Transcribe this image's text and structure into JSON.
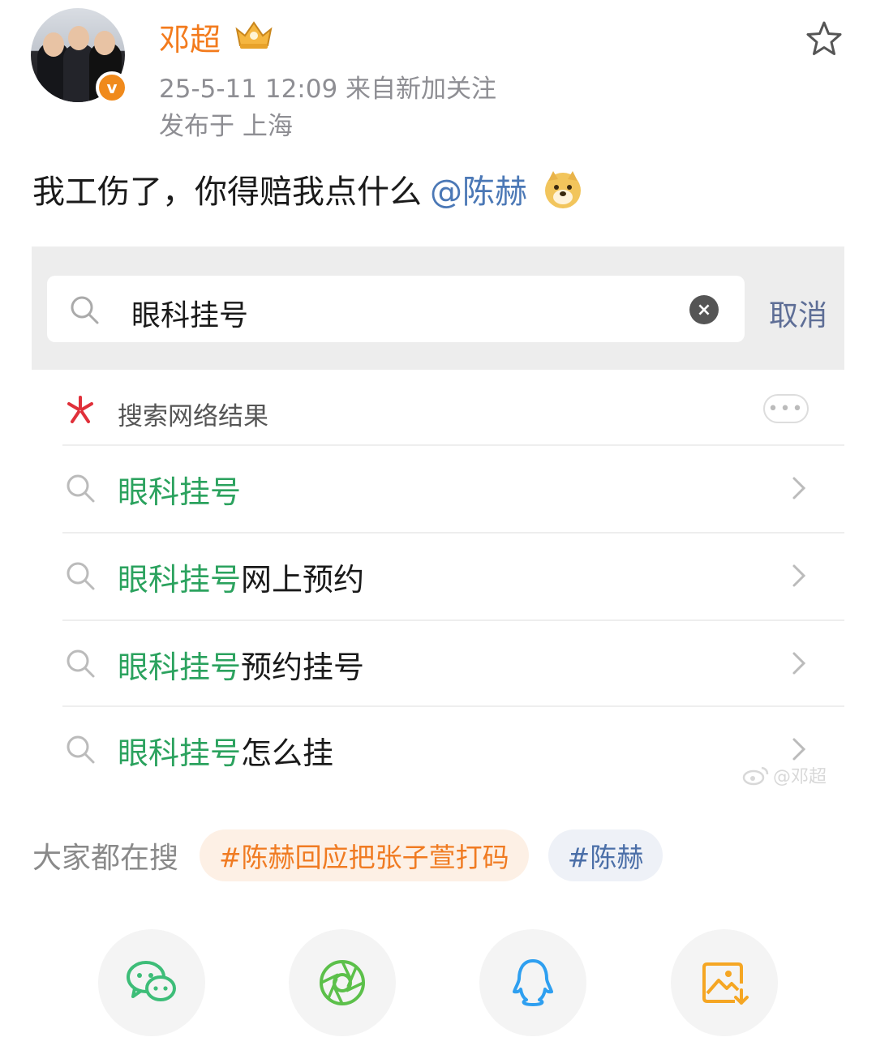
{
  "post": {
    "username": "邓超",
    "verified_mark": "v",
    "meta": "25-5-11 12:09  来自新加关注",
    "location": "发布于 上海",
    "text": "我工伤了，你得赔我点什么",
    "mention": "@陈赫"
  },
  "screenshot": {
    "search_query": "眼科挂号",
    "cancel_label": "取消",
    "clear_label": "×",
    "web_results_label": "搜索网络结果",
    "more_label": "•••",
    "suggestions": [
      {
        "highlight": "眼科挂号",
        "rest": ""
      },
      {
        "highlight": "眼科挂号",
        "rest": "网上预约"
      },
      {
        "highlight": "眼科挂号",
        "rest": "预约挂号"
      },
      {
        "highlight": "眼科挂号",
        "rest": "怎么挂"
      }
    ],
    "watermark": "@邓超"
  },
  "trending": {
    "label": "大家都在搜",
    "chips": [
      "#陈赫回应把张子萱打码",
      "#陈赫"
    ]
  },
  "share_actions": [
    "wechat-icon",
    "moments-icon",
    "qq-icon",
    "save-image-icon"
  ],
  "colors": {
    "username": "#f37b1d",
    "mention": "#4b78b6",
    "search_highlight": "#2ba25e",
    "hot_chip": "#f07b22",
    "blue_chip": "#4b6fa8"
  }
}
